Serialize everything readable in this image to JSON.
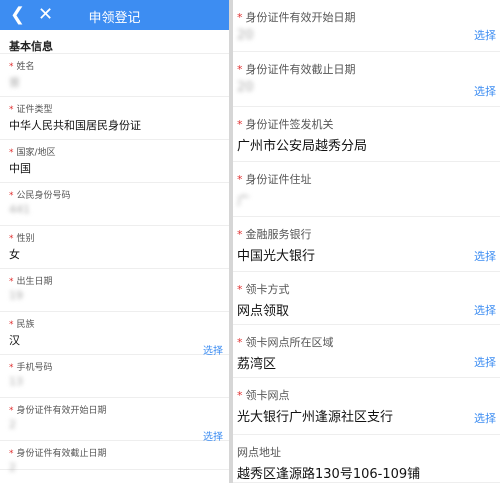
{
  "header": {
    "title": "申领登记",
    "back_icon": "chevron-left-icon",
    "close_icon": "close-icon"
  },
  "section_title": "基本信息",
  "left_fields": [
    {
      "label": "姓名",
      "value": "曾",
      "blurred": true,
      "pick": ""
    },
    {
      "label": "证件类型",
      "value": "中华人民共和国居民身份证",
      "blurred": false,
      "pick": ""
    },
    {
      "label": "国家/地区",
      "value": "中国",
      "blurred": false,
      "pick": ""
    },
    {
      "label": "公民身份号码",
      "value": "441",
      "blurred": true,
      "pick": ""
    },
    {
      "label": "性别",
      "value": "女",
      "blurred": false,
      "pick": ""
    },
    {
      "label": "出生日期",
      "value": "19",
      "blurred": true,
      "pick": ""
    },
    {
      "label": "民族",
      "value": "汉",
      "blurred": false,
      "pick": "选择"
    },
    {
      "label": "手机号码",
      "value": "13",
      "blurred": true,
      "pick": ""
    },
    {
      "label": "身份证件有效开始日期",
      "value": "2",
      "blurred": true,
      "pick": "选择"
    },
    {
      "label": "身份证件有效截止日期",
      "value": "2",
      "blurred": true,
      "pick": ""
    }
  ],
  "right_fields": [
    {
      "label": "身份证件有效开始日期",
      "value": "20",
      "blurred": true,
      "pick": "选择",
      "required": true
    },
    {
      "label": "身份证件有效截止日期",
      "value": "20",
      "blurred": true,
      "pick": "选择",
      "required": true
    },
    {
      "label": "身份证件签发机关",
      "value": "广州市公安局越秀分局",
      "blurred": false,
      "pick": "",
      "required": true
    },
    {
      "label": "身份证件住址",
      "value": "广",
      "blurred": true,
      "pick": "",
      "required": true
    },
    {
      "label": "金融服务银行",
      "value": "中国光大银行",
      "blurred": false,
      "pick": "选择",
      "required": true
    },
    {
      "label": "领卡方式",
      "value": "网点领取",
      "blurred": false,
      "pick": "选择",
      "required": true
    },
    {
      "label": "领卡网点所在区域",
      "value": "荔湾区",
      "blurred": false,
      "pick": "选择",
      "required": true
    },
    {
      "label": "领卡网点",
      "value": "光大银行广州逢源社区支行",
      "blurred": false,
      "pick": "选择",
      "required": true
    },
    {
      "label": "网点地址",
      "value": "越秀区逢源路130号106-109铺",
      "blurred": false,
      "pick": "",
      "required": false
    }
  ]
}
